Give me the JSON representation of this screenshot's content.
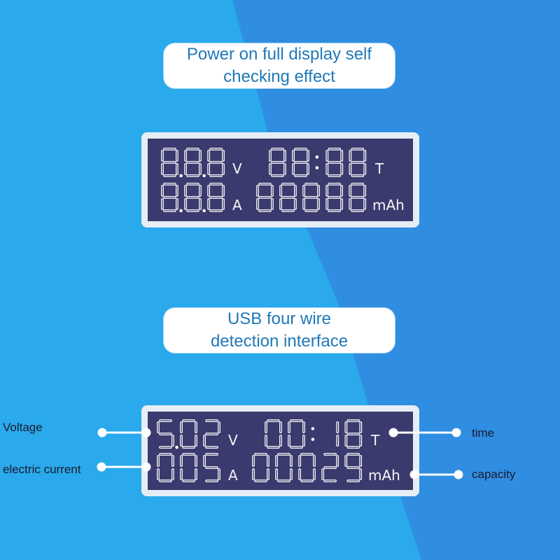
{
  "colors": {
    "bg_light": "#2aa9ec",
    "bg_dark": "#2f8ee2",
    "bubble_text": "#1f78b8",
    "lcd_screen": "#3b3a6e",
    "lcd_frame": "#e6eef5",
    "segment": "#ffffff",
    "label_text": "#1b1b2e"
  },
  "section1": {
    "caption_line1": "Power on full display self",
    "caption_line2": "checking effect",
    "lcd": {
      "voltage": "8.8.8",
      "voltage_unit": "V",
      "time": "88:88",
      "time_unit": "T",
      "current": "8.8.8",
      "current_unit": "A",
      "capacity": "88888",
      "capacity_unit": "mAh"
    }
  },
  "section2": {
    "caption_line1": "USB four wire",
    "caption_line2": "detection interface",
    "lcd": {
      "voltage": "5.02",
      "voltage_unit": "V",
      "time": "00:18",
      "time_unit": "T",
      "current": "005",
      "current_unit": "A",
      "capacity": "00029",
      "capacity_unit": "mAh"
    },
    "labels": {
      "voltage": "Voltage",
      "current": "electric current",
      "time": "time",
      "capacity": "capacity"
    }
  }
}
